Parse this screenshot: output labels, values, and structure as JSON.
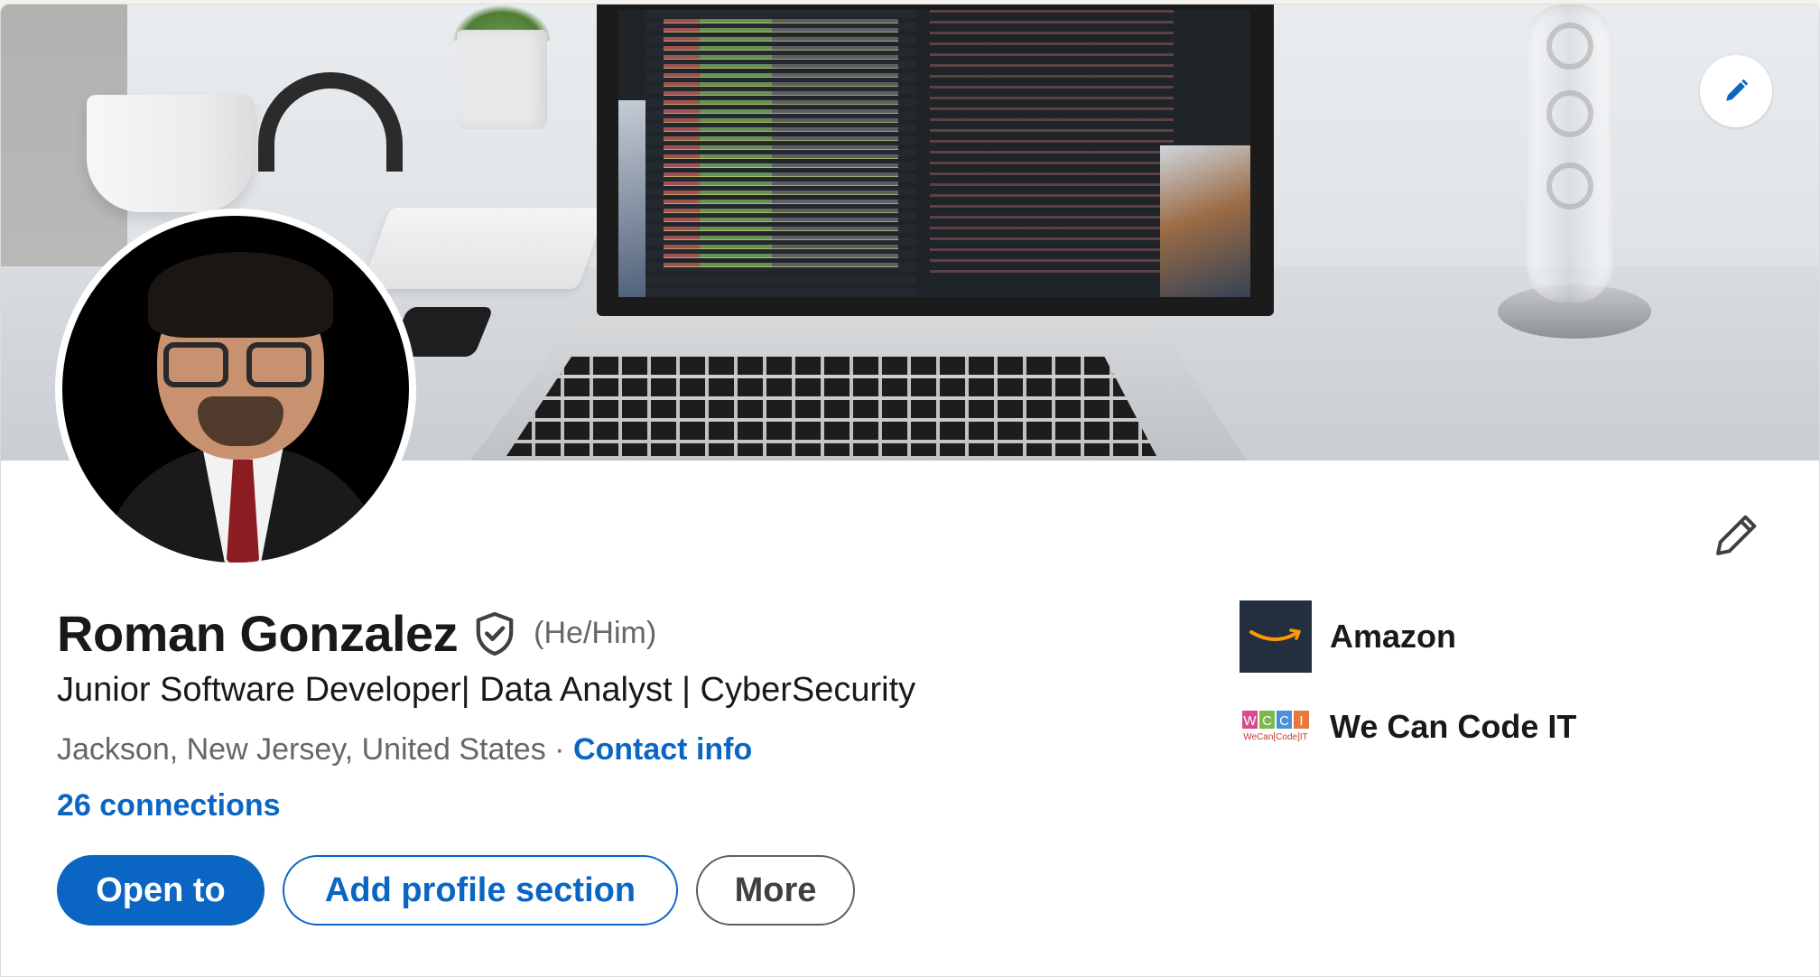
{
  "profile": {
    "name": "Roman Gonzalez",
    "pronouns": "(He/Him)",
    "headline": "Junior Software Developer| Data Analyst | CyberSecurity",
    "location": "Jackson, New Jersey, United States",
    "separator": " · ",
    "contact_info": "Contact info",
    "connections": "26 connections"
  },
  "actions": {
    "open_to": "Open to",
    "add_section": "Add profile section",
    "more": "More"
  },
  "companies": [
    {
      "name": "Amazon",
      "logo": "amazon-logo"
    },
    {
      "name": "We Can Code IT",
      "logo": "wecancodeit-logo",
      "logo_text": "WCCI",
      "logo_subtext": "WeCan[Code]IT"
    }
  ],
  "icons": {
    "banner_edit": "pencil-icon",
    "intro_edit": "pencil-icon",
    "verified": "shield-check-icon"
  },
  "colors": {
    "primary": "#0a66c2",
    "text": "#191919",
    "muted": "#666666",
    "amazon_bg": "#232f3e",
    "amazon_smile": "#ff9900"
  }
}
